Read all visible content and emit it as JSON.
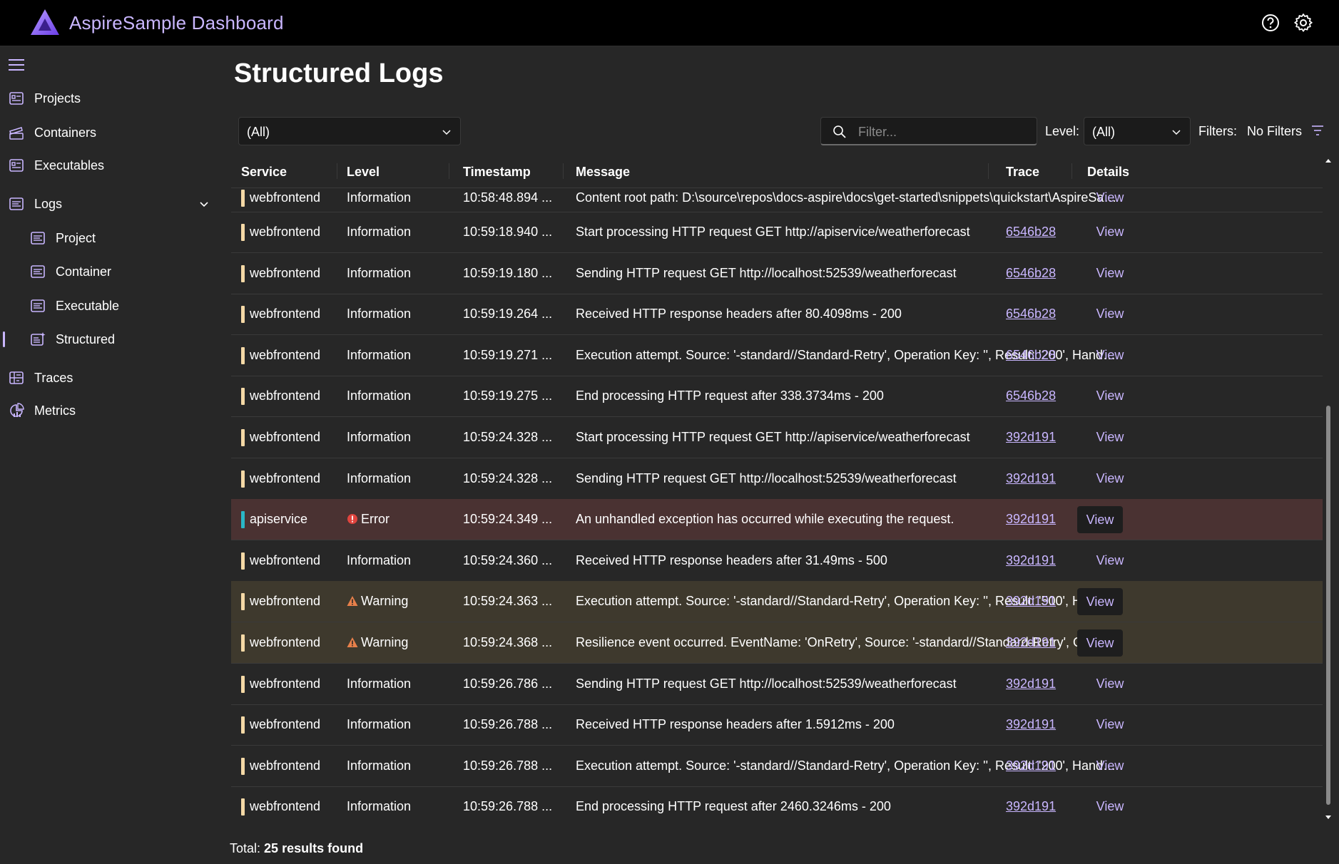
{
  "header": {
    "app_title": "AspireSample Dashboard",
    "icons": [
      "help-icon",
      "gear-icon"
    ]
  },
  "sidebar": {
    "items": [
      {
        "label": "Projects",
        "icon": "projects-icon"
      },
      {
        "label": "Containers",
        "icon": "containers-icon"
      },
      {
        "label": "Executables",
        "icon": "executables-icon"
      },
      {
        "label": "Logs",
        "icon": "logs-icon",
        "expanded": true
      },
      {
        "label": "Project",
        "icon": "log-project-icon"
      },
      {
        "label": "Container",
        "icon": "log-container-icon"
      },
      {
        "label": "Executable",
        "icon": "log-executable-icon"
      },
      {
        "label": "Structured",
        "icon": "structured-log-icon",
        "selected": true
      },
      {
        "label": "Traces",
        "icon": "traces-icon"
      },
      {
        "label": "Metrics",
        "icon": "metrics-icon"
      }
    ]
  },
  "page": {
    "title": "Structured Logs"
  },
  "toolbar": {
    "resource_value": "(All)",
    "filter_placeholder": "Filter...",
    "level_label": "Level:",
    "level_value": "(All)",
    "filters_label": "Filters:",
    "filters_value": "No Filters"
  },
  "grid": {
    "columns": [
      "Service",
      "Level",
      "Timestamp",
      "Message",
      "Trace",
      "Details"
    ],
    "view_label": "View",
    "rows": [
      {
        "service": "webfrontend",
        "level": "Information",
        "timestamp": "10:58:48.894 ...",
        "message": "Content root path: D:\\source\\repos\\docs-aspire\\docs\\get-started\\snippets\\quickstart\\AspireSam...",
        "trace": ""
      },
      {
        "service": "webfrontend",
        "level": "Information",
        "timestamp": "10:59:18.940 ...",
        "message": "Start processing HTTP request GET http://apiservice/weatherforecast",
        "trace": "6546b28"
      },
      {
        "service": "webfrontend",
        "level": "Information",
        "timestamp": "10:59:19.180 ...",
        "message": "Sending HTTP request GET http://localhost:52539/weatherforecast",
        "trace": "6546b28"
      },
      {
        "service": "webfrontend",
        "level": "Information",
        "timestamp": "10:59:19.264 ...",
        "message": "Received HTTP response headers after 80.4098ms - 200",
        "trace": "6546b28"
      },
      {
        "service": "webfrontend",
        "level": "Information",
        "timestamp": "10:59:19.271 ...",
        "message": "Execution attempt. Source: '-standard//Standard-Retry', Operation Key: '', Result: '200', Handled: '...",
        "trace": "6546b28"
      },
      {
        "service": "webfrontend",
        "level": "Information",
        "timestamp": "10:59:19.275 ...",
        "message": "End processing HTTP request after 338.3734ms - 200",
        "trace": "6546b28"
      },
      {
        "service": "webfrontend",
        "level": "Information",
        "timestamp": "10:59:24.328 ...",
        "message": "Start processing HTTP request GET http://apiservice/weatherforecast",
        "trace": "392d191"
      },
      {
        "service": "webfrontend",
        "level": "Information",
        "timestamp": "10:59:24.328 ...",
        "message": "Sending HTTP request GET http://localhost:52539/weatherforecast",
        "trace": "392d191"
      },
      {
        "service": "apiservice",
        "level": "Error",
        "timestamp": "10:59:24.349 ...",
        "message": "An unhandled exception has occurred while executing the request.",
        "trace": "392d191"
      },
      {
        "service": "webfrontend",
        "level": "Information",
        "timestamp": "10:59:24.360 ...",
        "message": "Received HTTP response headers after 31.49ms - 500",
        "trace": "392d191"
      },
      {
        "service": "webfrontend",
        "level": "Warning",
        "timestamp": "10:59:24.363 ...",
        "message": "Execution attempt. Source: '-standard//Standard-Retry', Operation Key: '', Result: '500', Handled: '...",
        "trace": "392d191"
      },
      {
        "service": "webfrontend",
        "level": "Warning",
        "timestamp": "10:59:24.368 ...",
        "message": "Resilience event occurred. EventName: 'OnRetry', Source: '-standard//Standard-Retry', Operation ...",
        "trace": "392d191"
      },
      {
        "service": "webfrontend",
        "level": "Information",
        "timestamp": "10:59:26.786 ...",
        "message": "Sending HTTP request GET http://localhost:52539/weatherforecast",
        "trace": "392d191"
      },
      {
        "service": "webfrontend",
        "level": "Information",
        "timestamp": "10:59:26.788 ...",
        "message": "Received HTTP response headers after 1.5912ms - 200",
        "trace": "392d191"
      },
      {
        "service": "webfrontend",
        "level": "Information",
        "timestamp": "10:59:26.788 ...",
        "message": "Execution attempt. Source: '-standard//Standard-Retry', Operation Key: '', Result: '200', Handled: '...",
        "trace": "392d191"
      },
      {
        "service": "webfrontend",
        "level": "Information",
        "timestamp": "10:59:26.788 ...",
        "message": "End processing HTTP request after 2460.3246ms - 200",
        "trace": "392d191"
      }
    ]
  },
  "footer": {
    "total_label": "Total:",
    "total_value": "25 results found"
  },
  "colors": {
    "accent": "#c9b6ff",
    "webfrontend": "#f5d9a6",
    "apiservice": "#2ab7c6",
    "error_row": "#4a3232",
    "warning_row": "#3e392d",
    "error_icon": "#e0443e",
    "warning_icon": "#e8804a"
  }
}
